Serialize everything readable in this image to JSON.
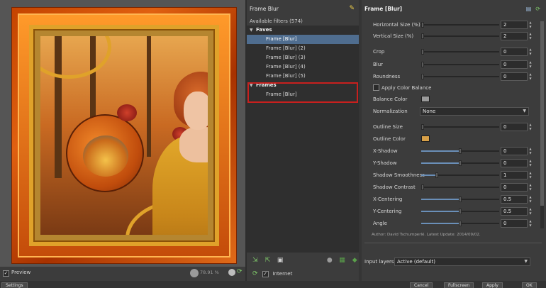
{
  "preview": {
    "preview_label": "Preview",
    "preview_checked": "✓",
    "zoom_value": "78.91 %"
  },
  "filters": {
    "title": "Frame Blur",
    "count_label": "Available filters (574)",
    "categories": [
      {
        "label": "Faves",
        "items": [
          "Frame [Blur]",
          "Frame [Blur] (2)",
          "Frame [Blur] (3)",
          "Frame [Blur] (4)",
          "Frame [Blur] (5)"
        ]
      },
      {
        "label": "Frames",
        "items": [
          "Frame [Blur]"
        ]
      }
    ],
    "internet_label": "Internet",
    "internet_checked": "✓"
  },
  "params": {
    "title": "Frame [Blur]",
    "rows": [
      {
        "label": "Horizontal Size (%)",
        "value": "2",
        "level": 0.02
      },
      {
        "label": "Vertical Size (%)",
        "value": "2",
        "level": 0.02
      },
      {
        "label": "Crop",
        "value": "0",
        "level": 0.0
      },
      {
        "label": "Blur",
        "value": "0",
        "level": 0.0
      },
      {
        "label": "Roundness",
        "value": "0",
        "level": 0.0
      },
      {
        "label": "Apply Color Balance",
        "type": "checkbox"
      },
      {
        "label": "Balance Color",
        "type": "color",
        "color": "#9a9a9a"
      },
      {
        "label": "Normalization",
        "type": "combo",
        "value": "None"
      },
      {
        "label": "Outline Size",
        "value": "0",
        "level": 0.0
      },
      {
        "label": "Outline Color",
        "type": "color",
        "color": "#d8a048"
      },
      {
        "label": "X-Shadow",
        "value": "0",
        "level": 0.5
      },
      {
        "label": "Y-Shadow",
        "value": "0",
        "level": 0.5
      },
      {
        "label": "Shadow Smoothness",
        "value": "1",
        "level": 0.2
      },
      {
        "label": "Shadow Contrast",
        "value": "0",
        "level": 0.0
      },
      {
        "label": "X-Centering",
        "value": "0.5",
        "level": 0.5
      },
      {
        "label": "Y-Centering",
        "value": "0.5",
        "level": 0.5
      },
      {
        "label": "Angle",
        "value": "0",
        "level": 0.5
      }
    ],
    "author_line": "Author: David Tschumperlé.      Latest Update: 2014/09/02.",
    "input_layers_label": "Input layers",
    "input_layers_value": "Active (default)"
  },
  "bottom": {
    "settings_label": "Settings",
    "cancel_label": "Cancel",
    "fullscreen_label": "Fullscreen",
    "apply_label": "Apply",
    "ok_label": "OK"
  },
  "colors": {
    "selection": "#4f6d8f",
    "highlight_box": "#c8201e"
  }
}
